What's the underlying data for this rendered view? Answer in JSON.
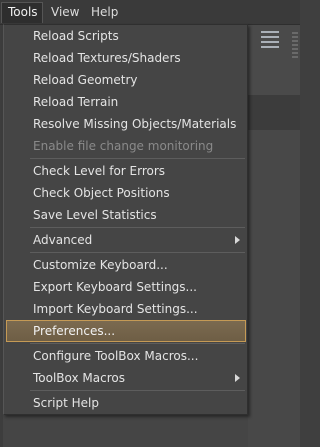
{
  "menubar": {
    "tools": "Tools",
    "view": "View",
    "help": "Help"
  },
  "menu": {
    "reload_scripts": "Reload Scripts",
    "reload_textures": "Reload Textures/Shaders",
    "reload_geometry": "Reload Geometry",
    "reload_terrain": "Reload Terrain",
    "resolve_missing": "Resolve Missing Objects/Materials",
    "enable_monitoring": "Enable file change monitoring",
    "check_level": "Check Level for Errors",
    "check_positions": "Check Object Positions",
    "save_stats": "Save Level Statistics",
    "advanced": "Advanced",
    "customize_keyboard": "Customize Keyboard...",
    "export_keyboard": "Export Keyboard Settings...",
    "import_keyboard": "Import Keyboard Settings...",
    "preferences": "Preferences...",
    "configure_toolbox": "Configure ToolBox Macros...",
    "toolbox_macros": "ToolBox Macros",
    "script_help": "Script Help"
  },
  "icons": {
    "submenu": "chevron-right-icon",
    "panel": "list-icon"
  },
  "colors": {
    "highlight_border": "#c59a55",
    "highlight_fill": "#7b6a50",
    "menu_bg": "#454545"
  }
}
